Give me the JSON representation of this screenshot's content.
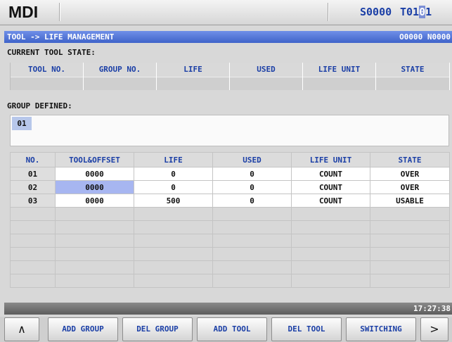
{
  "header": {
    "mode": "MDI",
    "spindle": "S0000",
    "tool_prefix": "T01",
    "tool_cursor": "0",
    "tool_suffix": "1"
  },
  "titlebar": {
    "path": "TOOL -> LIFE MANAGEMENT",
    "program": "O0000 N0000"
  },
  "current_state": {
    "label": "CURRENT TOOL STATE:",
    "columns": [
      "TOOL NO.",
      "GROUP NO.",
      "LIFE",
      "USED",
      "LIFE UNIT",
      "STATE"
    ],
    "row": [
      "",
      "",
      "",
      "",
      "",
      ""
    ]
  },
  "group_defined": {
    "label": "GROUP DEFINED:",
    "groups": [
      "01"
    ]
  },
  "life_table": {
    "columns": [
      "NO.",
      "TOOL&OFFSET",
      "LIFE",
      "USED",
      "LIFE UNIT",
      "STATE"
    ],
    "rows": [
      {
        "no": "01",
        "tool": "0000",
        "life": "0",
        "used": "0",
        "unit": "COUNT",
        "state": "OVER"
      },
      {
        "no": "02",
        "tool": "0000",
        "life": "0",
        "used": "0",
        "unit": "COUNT",
        "state": "OVER"
      },
      {
        "no": "03",
        "tool": "0000",
        "life": "500",
        "used": "0",
        "unit": "COUNT",
        "state": "USABLE"
      }
    ]
  },
  "status": {
    "time": "17:27:38"
  },
  "softkeys": {
    "prev": "∧",
    "add_group": "ADD GROUP",
    "del_group": "DEL GROUP",
    "add_tool": "ADD TOOL",
    "del_tool": "DEL TOOL",
    "switching": "SWITCHING",
    "next": ">"
  },
  "colors": {
    "title_bar": "#4f72d6",
    "header_text": "#1b3fa6",
    "selection": "#a7b6f1"
  }
}
